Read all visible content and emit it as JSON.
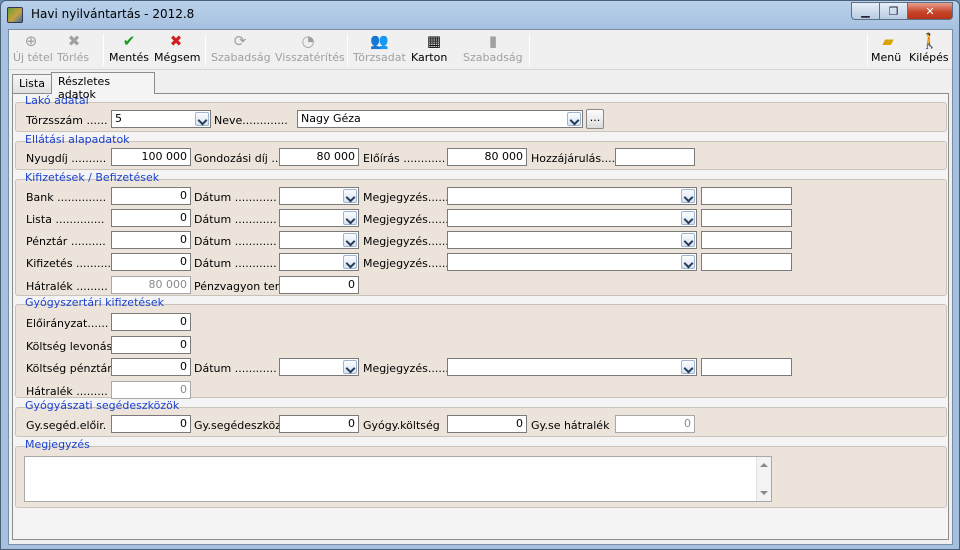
{
  "window": {
    "title": "Havi nyilvántartás - 2012.8",
    "minimize": "▁",
    "restore": "❐",
    "close": "✕"
  },
  "toolbar": {
    "new": "Új tétel",
    "delete": "Törlés",
    "save": "Mentés",
    "cancel": "Mégsem",
    "leave": "Szabadság",
    "return": "Visszatérítés",
    "master": "Törzsadat",
    "card": "Karton",
    "leave2": "Szabadság",
    "menu": "Menü",
    "exit": "Kilépés"
  },
  "tabs": {
    "list": "Lista",
    "details": "Részletes adatok"
  },
  "resident": {
    "title": "Lakó adatai",
    "id_label": "Törzsszám ......",
    "id_value": "5",
    "name_label": "Neve.............",
    "name_value": "Nagy Géza",
    "browse": "..."
  },
  "care": {
    "title": "Ellátási alapadatok",
    "pension_label": "Nyugdíj ..........",
    "pension_value": "100 000",
    "fee_label": "Gondozási díj ...",
    "fee_value": "80 000",
    "prescribed_label": "Előírás ............",
    "prescribed_value": "80 000",
    "contribution_label": "Hozzájárulás....",
    "contribution_value": ""
  },
  "payments": {
    "title": "Kifizetések / Befizetések",
    "rows": [
      {
        "label": "Bank ..............",
        "value": "0"
      },
      {
        "label": "Lista ..............",
        "value": "0"
      },
      {
        "label": "Pénztár ..........",
        "value": "0"
      },
      {
        "label": "Kifizetés ..........",
        "value": "0"
      }
    ],
    "date_label": "Dátum ............",
    "note_label": "Megjegyzés......",
    "arrears_label": "Hátralék .........",
    "arrears_value": "80 000",
    "assets_label": "Pénzvagyon ter.",
    "assets_value": "0"
  },
  "pharmacy": {
    "title": "Gyógyszertári kifizetések",
    "forecast_label": "Előirányzat......",
    "forecast_value": "0",
    "deduction_label": "Költség levonás",
    "deduction_value": "0",
    "cash_label": "Költség pénztár",
    "cash_value": "0",
    "date_label": "Dátum ............",
    "note_label": "Megjegyzés......",
    "arrears_label": "Hátralék .........",
    "arrears_value": "0"
  },
  "aids": {
    "title": "Gyógyászati segédeszközök",
    "forecast_label": "Gy.segéd.előir.",
    "forecast_value": "0",
    "aid_label": "Gy.segédeszköz",
    "aid_value": "0",
    "cost_label": "Gyógy.költség",
    "cost_value": "0",
    "arrears_label": "Gy.se hátralék",
    "arrears_value": "0"
  },
  "notes": {
    "title": "Megjegyzés",
    "value": ""
  }
}
